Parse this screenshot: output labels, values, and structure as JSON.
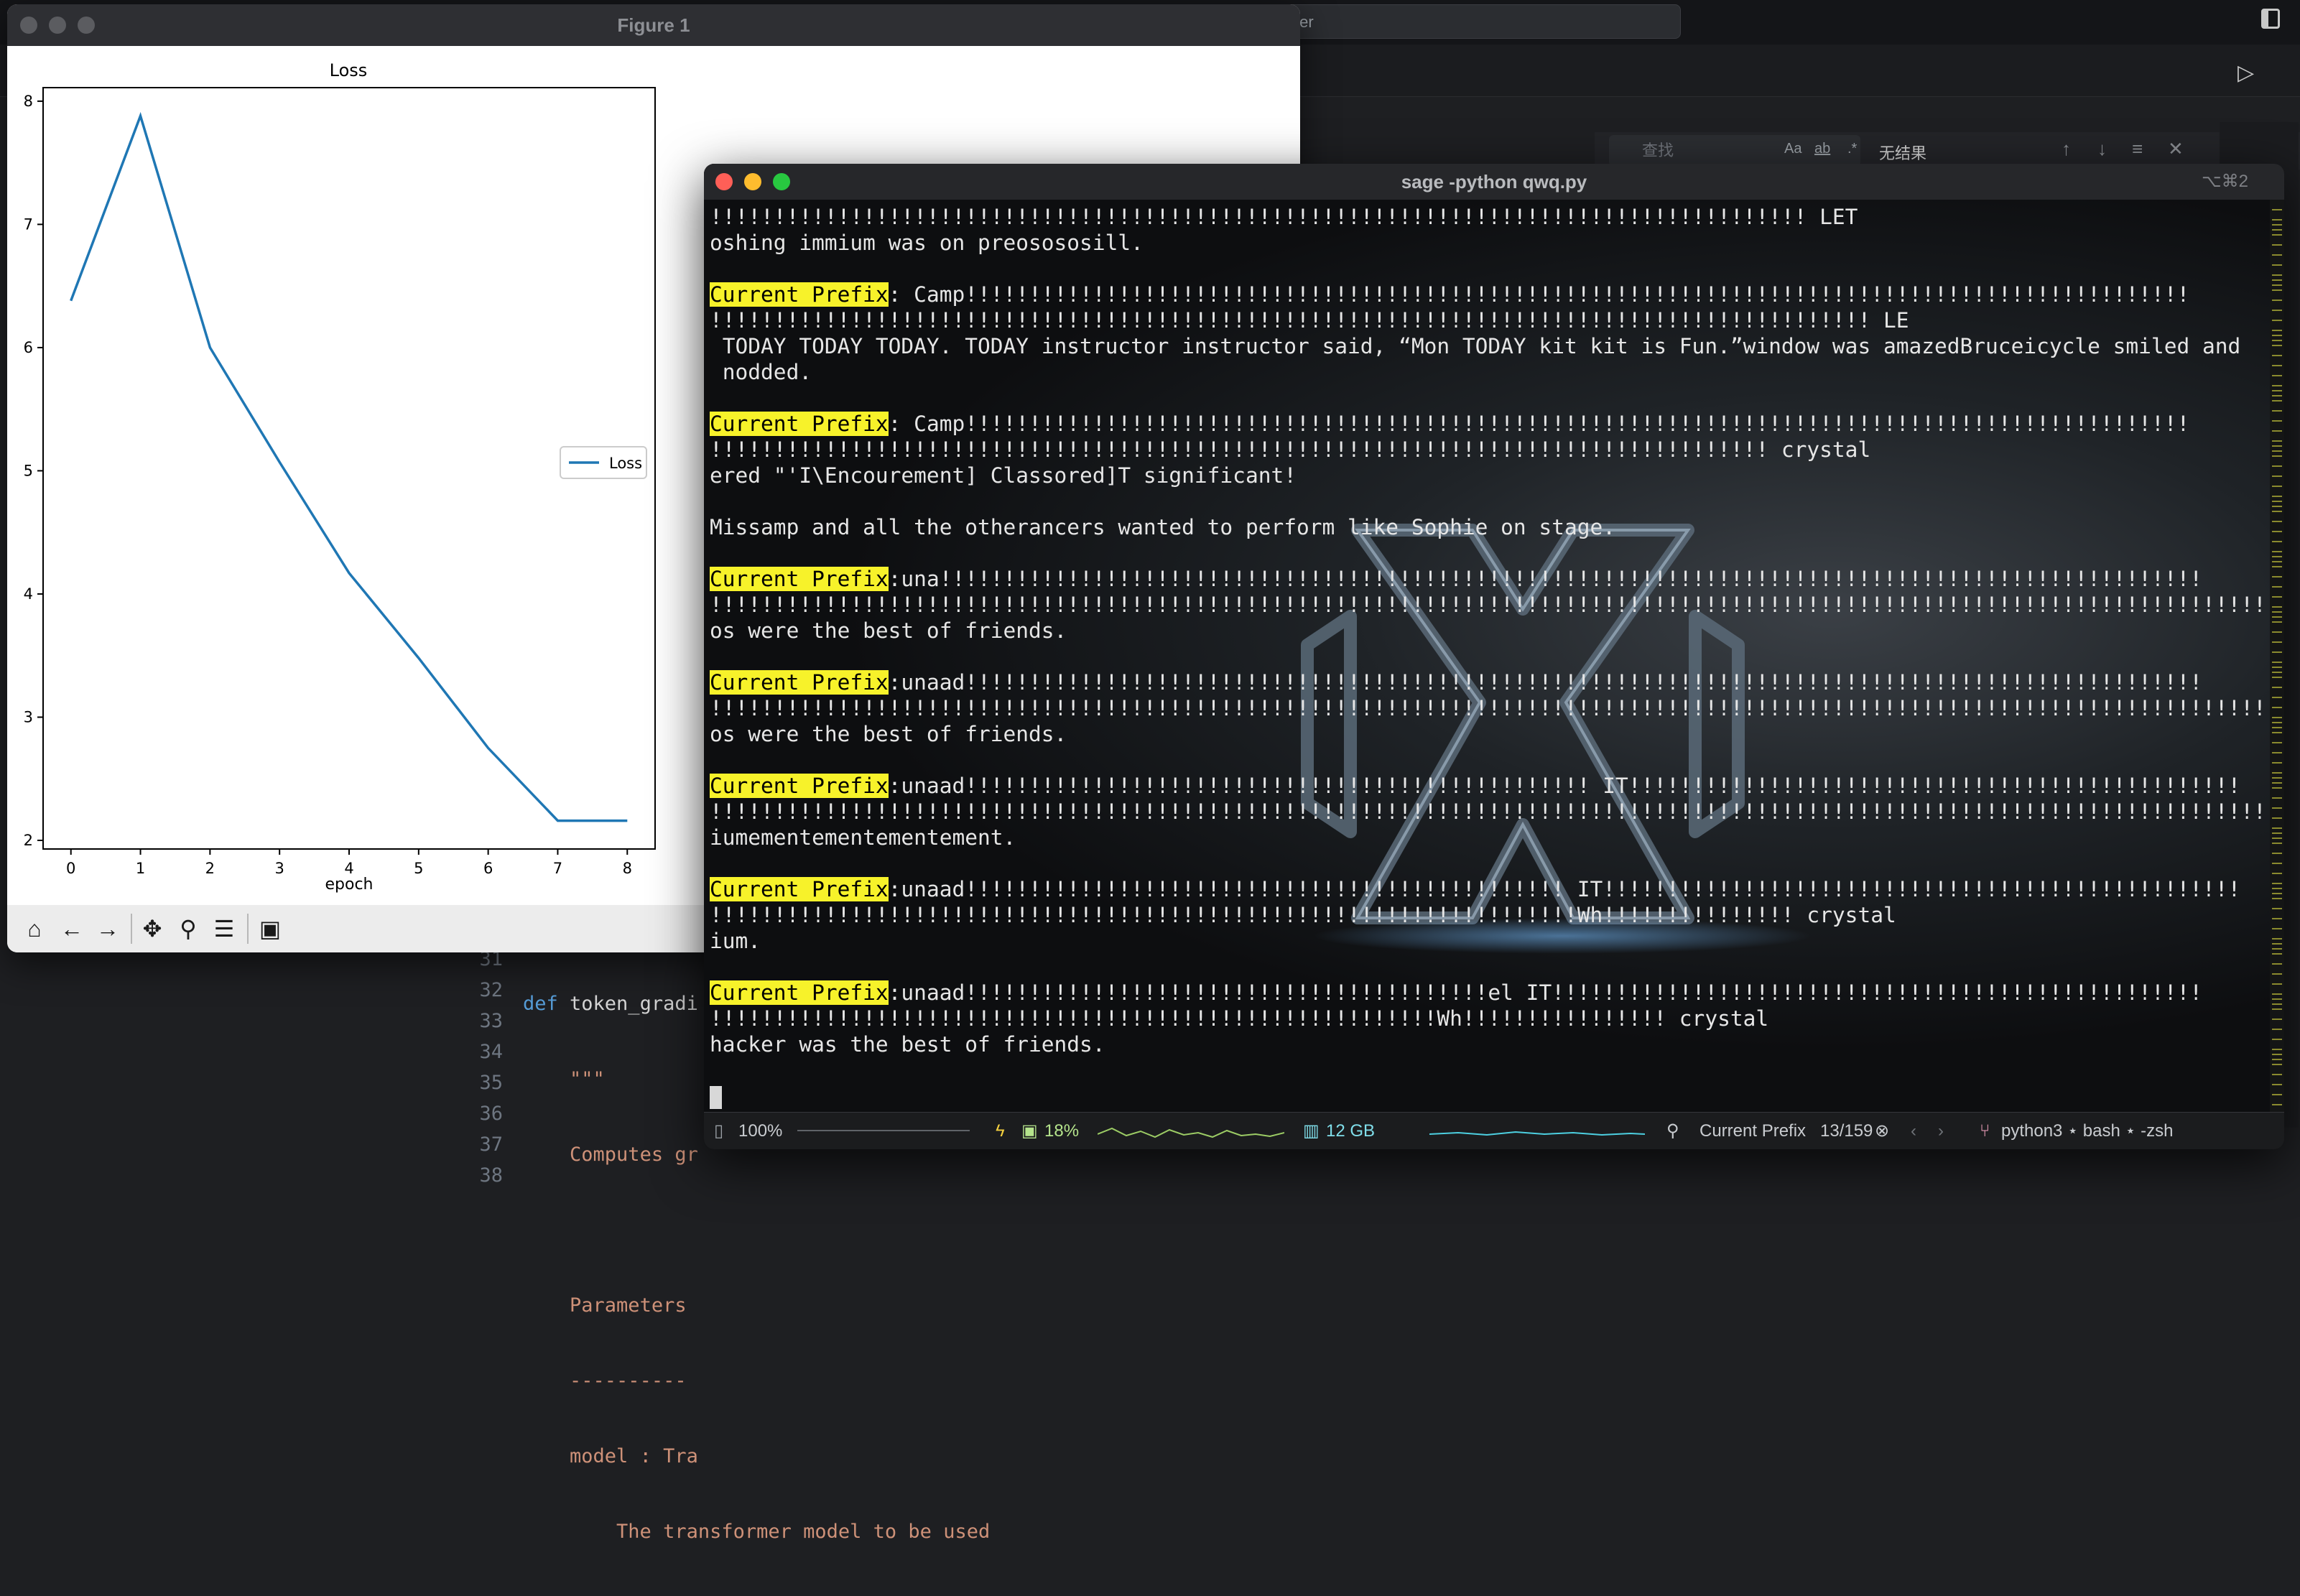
{
  "editor": {
    "command_search_text": "ter",
    "find": {
      "placeholder": "查找",
      "opt_case": "Aa",
      "opt_word": "ab",
      "opt_regex": ".*",
      "result": "无结果"
    },
    "gutter": [
      "31",
      "32",
      "33",
      "34",
      "35",
      "36",
      "37",
      "38"
    ],
    "code_lines": [
      {
        "a": "def ",
        "b": "token_gradi"
      },
      {
        "a": "    ",
        "b": "\"\"\""
      },
      {
        "a": "    ",
        "b": "Computes gr"
      },
      {
        "a": "",
        "b": ""
      },
      {
        "a": "    ",
        "b": "Parameters"
      },
      {
        "a": "    ",
        "b": "----------"
      },
      {
        "a": "    ",
        "b": "model : Tra"
      },
      {
        "a": "        ",
        "b": "The transformer model to be used"
      }
    ]
  },
  "figure": {
    "window_title": "Figure 1",
    "toolbar_icons": [
      "home-icon",
      "back-arrow-icon",
      "forward-arrow-icon",
      "pan-icon",
      "zoom-icon",
      "configure-icon",
      "save-icon"
    ]
  },
  "chart_data": {
    "type": "line",
    "title": "Loss",
    "xlabel": "epoch",
    "ylabel": "",
    "x": [
      0,
      1,
      2,
      3,
      4,
      5,
      6,
      7,
      8
    ],
    "x_ticks": [
      "0",
      "1",
      "2",
      "3",
      "4",
      "5",
      "6",
      "7",
      "8"
    ],
    "y_ticks": [
      "2",
      "3",
      "4",
      "5",
      "6",
      "7",
      "8"
    ],
    "series": [
      {
        "name": "Loss",
        "values": [
          6.38,
          7.88,
          6.0,
          5.07,
          4.17,
          3.48,
          2.75,
          2.16,
          2.16
        ],
        "color": "#1f77b4"
      }
    ],
    "xlim": [
      -0.4,
      8.4
    ],
    "ylim": [
      1.93,
      8.11
    ],
    "legend": "center-right",
    "grid": false
  },
  "terminal": {
    "title": "sage -python qwq.py",
    "shortcut": "⌥⌘2",
    "lines": [
      {
        "pre": "",
        "hl": "",
        "rest": "!!!!!!!!!!!!!!!!!!!!!!!!!!!!!!!!!!!!!!!!!!!!!!!!!!!!!!!!!!!!!!!!!!!!!!!!!!!!!!!!!!!!!! LET"
      },
      {
        "pre": "",
        "hl": "",
        "rest": "oshing immium was on preosososill."
      },
      {
        "pre": "",
        "hl": "",
        "rest": ""
      },
      {
        "pre": "",
        "hl": "Current Prefix",
        "rest": ": Camp!!!!!!!!!!!!!!!!!!!!!!!!!!!!!!!!!!!!!!!!!!!!!!!!!!!!!!!!!!!!!!!!!!!!!!!!!!!!!!!!!!!!!!!!!!!!!!!!"
      },
      {
        "pre": "",
        "hl": "",
        "rest": "!!!!!!!!!!!!!!!!!!!!!!!!!!!!!!!!!!!!!!!!!!!!!!!!!!!!!!!!!!!!!!!!!!!!!!!!!!!!!!!!!!!!!!!!!!! LE"
      },
      {
        "pre": "",
        "hl": "",
        "rest": " TODAY TODAY TODAY. TODAY instructor instructor said, “Mon TODAY kit kit is Fun.”window was amazedBruceicycle smiled and"
      },
      {
        "pre": "",
        "hl": "",
        "rest": " nodded."
      },
      {
        "pre": "",
        "hl": "",
        "rest": ""
      },
      {
        "pre": "",
        "hl": "Current Prefix",
        "rest": ": Camp!!!!!!!!!!!!!!!!!!!!!!!!!!!!!!!!!!!!!!!!!!!!!!!!!!!!!!!!!!!!!!!!!!!!!!!!!!!!!!!!!!!!!!!!!!!!!!!!"
      },
      {
        "pre": "",
        "hl": "",
        "rest": "!!!!!!!!!!!!!!!!!!!!!!!!!!!!!!!!!!!!!!!!!!!!!!!!!!!!!!!!!!!!!!!!!!!!!!!!!!!!!!!!!!! crystal"
      },
      {
        "pre": "",
        "hl": "",
        "rest": "ered \"'I\\Encourement] Classored]T significant!"
      },
      {
        "pre": "",
        "hl": "",
        "rest": ""
      },
      {
        "pre": "",
        "hl": "",
        "rest": "Missamp and all the otherancers wanted to perform like Sophie on stage."
      },
      {
        "pre": "",
        "hl": "",
        "rest": ""
      },
      {
        "pre": "",
        "hl": "Current Prefix",
        "rest": ":una!!!!!!!!!!!!!!!!!!!!!!!!!!!!!!!!!!!!!!!!!!!!!!!!!!!!!!!!!!!!!!!!!!!!!!!!!!!!!!!!!!!!!!!!!!!!!!!!!!!"
      },
      {
        "pre": "",
        "hl": "",
        "rest": "!!!!!!!!!!!!!!!!!!!!!!!!!!!!!!!!!!!!!!!!!!!!!!!!!!!!!!!!!!!!!!!!!!!!!!!!!!!!!!!!!!!!!!!!!!!!!!!!!!!!!!!!!!!!!!!!!!!!!!!!!!!!!!!!!!!!!!!!!!!!!!!!!!!!! crystal"
      },
      {
        "pre": "",
        "hl": "",
        "rest": "os were the best of friends."
      },
      {
        "pre": "",
        "hl": "",
        "rest": ""
      },
      {
        "pre": "",
        "hl": "Current Prefix",
        "rest": ":unaad!!!!!!!!!!!!!!!!!!!!!!!!!!!!!!!!!!!!!!!!!!!!!!!!!!!!!!!!!!!!!!!!!!!!!!!!!!!!!!!!!!!!!!!!!!!!!!!!!"
      },
      {
        "pre": "",
        "hl": "",
        "rest": "!!!!!!!!!!!!!!!!!!!!!!!!!!!!!!!!!!!!!!!!!!!!!!!!!!!!!!!!!!!!!!!!!!!!!!!!!!!!!!!!!!!!!!!!!!!!!!!!!!!!!!!!!!!!!!!!!!!!!!!!!!!!!!!!!!!!!!!!!!!!!!!!! crystal"
      },
      {
        "pre": "",
        "hl": "",
        "rest": "os were the best of friends."
      },
      {
        "pre": "",
        "hl": "",
        "rest": ""
      },
      {
        "pre": "",
        "hl": "Current Prefix",
        "rest": ":unaad!!!!!!!!!!!!!!!!!!!!!!!!!!!!!!!!!!!!!!!!!!!!!!!!! IT!!!!!!!!!!!!!!!!!!!!!!!!!!!!!!!!!!!!!!!!!!!!!!!!"
      },
      {
        "pre": "",
        "hl": "",
        "rest": "!!!!!!!!!!!!!!!!!!!!!!!!!!!!!!!!!!!!!!!!!!!!!!!!!!!!!!!!!!!!!!!!!!!!!!!!!!!!!!!!!!!!!!!!!!!!!!!!!!!!!!!!!!!!!!!!!!!!!!!!!!!!!!!!!!!!!!! crystal"
      },
      {
        "pre": "",
        "hl": "",
        "rest": "iumementementementement."
      },
      {
        "pre": "",
        "hl": "",
        "rest": ""
      },
      {
        "pre": "",
        "hl": "Current Prefix",
        "rest": ":unaad!!!!!!!!!!!!!!!!!!!!!!!!!!!!!!!!!!!!!!!!!!!!!!! IT!!!!!!!!!!!!!!!!!!!!!!!!!!!!!!!!!!!!!!!!!!!!!!!!!!"
      },
      {
        "pre": "",
        "hl": "",
        "rest": "!!!!!!!!!!!!!!!!!!!!!!!!!!!!!!!!!!!!!!!!!!!!!!!!!!!!!!!!!!!!!!!!!!!!Wh!!!!!!!!!!!!!!! crystal"
      },
      {
        "pre": "",
        "hl": "",
        "rest": "ium."
      },
      {
        "pre": "",
        "hl": "",
        "rest": ""
      },
      {
        "pre": "",
        "hl": "Current Prefix",
        "rest": ":unaad!!!!!!!!!!!!!!!!!!!!!!!!!!!!!!!!!!!!!!!!!el IT!!!!!!!!!!!!!!!!!!!!!!!!!!!!!!!!!!!!!!!!!!!!!!!!!!!"
      },
      {
        "pre": "",
        "hl": "",
        "rest": "!!!!!!!!!!!!!!!!!!!!!!!!!!!!!!!!!!!!!!!!!!!!!!!!!!!!!!!!!Wh!!!!!!!!!!!!!!!! crystal"
      },
      {
        "pre": "",
        "hl": "",
        "rest": "hacker was the best of friends."
      }
    ],
    "status": {
      "zoom": "100%",
      "cpu": "18%",
      "memory": "12 GB",
      "search_term": "Current Prefix",
      "match_count": "13/159",
      "job": "python3 ⋆ bash ⋆ -zsh"
    },
    "colors": {
      "highlight": "#f7f22a",
      "text": "#e6e6e6"
    }
  }
}
